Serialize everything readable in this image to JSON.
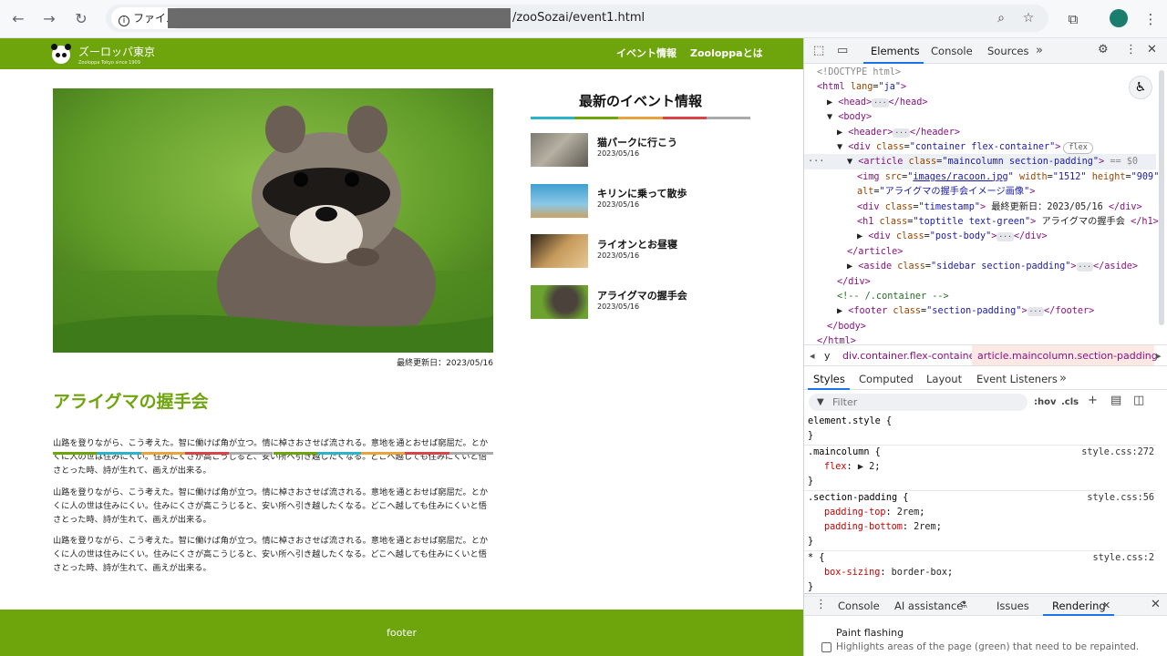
{
  "browser": {
    "file_chip": "ファイル",
    "url_path": "/zooSozai/event1.html",
    "icons": [
      "back-arrow-icon",
      "forward-arrow-icon",
      "reload-icon",
      "zoom-icon",
      "star-icon",
      "extensions-icon",
      "profile-icon",
      "menu-icon"
    ]
  },
  "site": {
    "brand": "ズーロッパ東京",
    "brand_sub": "Zooloppa Tokyo since 1909",
    "nav": [
      "イベント情報",
      "Zooloppaとは"
    ],
    "hero_alt": "アライグマの握手会イメージ画像",
    "timestamp": "最終更新日：2023/05/16",
    "title": "アライグマの握手会",
    "stripe_colors": [
      "#6ea40c",
      "#2bb3c9",
      "#e8a33c",
      "#d9434a",
      "#aaaaaa",
      "#6ea40c",
      "#2bb3c9",
      "#e8a33c",
      "#d9434a",
      "#aaaaaa"
    ],
    "paragraphs": [
      "山路を登りながら、こう考えた。智に働けば角が立つ。情に棹さおさせば流される。意地を通とおせば窮屈だ。とかくに人の世は住みにくい。住みにくさが高こうじると、安い所へ引き越したくなる。どこへ越しても住みにくいと悟さとった時、詩が生れて、画えが出来る。",
      "山路を登りながら、こう考えた。智に働けば角が立つ。情に棹さおさせば流される。意地を通とおせば窮屈だ。とかくに人の世は住みにくい。住みにくさが高こうじると、安い所へ引き越したくなる。どこへ越しても住みにくいと悟さとった時、詩が生れて、画えが出来る。",
      "山路を登りながら、こう考えた。智に働けば角が立つ。情に棹さおさせば流される。意地を通とおせば窮屈だ。とかくに人の世は住みにくい。住みにくさが高こうじると、安い所へ引き越したくなる。どこへ越しても住みにくいと悟さとった時、詩が生れて、画えが出来る。"
    ],
    "sidebar_title": "最新のイベント情報",
    "sidebar_stripe": [
      "#2bb3c9",
      "#6ea40c",
      "#e8a33c",
      "#d9434a",
      "#aaaaaa"
    ],
    "events": [
      {
        "title": "猫パークに行こう",
        "date": "2023/05/16"
      },
      {
        "title": "キリンに乗って散歩",
        "date": "2023/05/16"
      },
      {
        "title": "ライオンとお昼寝",
        "date": "2023/05/16"
      },
      {
        "title": "アライグマの握手会",
        "date": "2023/05/16"
      }
    ],
    "footer": "footer"
  },
  "devtools": {
    "tabs": [
      "Elements",
      "Console",
      "Sources"
    ],
    "dom_lines": [
      {
        "indent": 0,
        "html": "<span class='dim'>&lt;!DOCTYPE html&gt;</span>"
      },
      {
        "indent": 0,
        "html": "<span class='tag'>&lt;html</span> <span class='attr'>lang</span>=<span class='val'>\"ja\"</span><span class='tag'>&gt;</span>"
      },
      {
        "indent": 1,
        "html": "▶ <span class='tag'>&lt;head&gt;</span><span class='ell'>···</span><span class='tag'>&lt;/head&gt;</span>"
      },
      {
        "indent": 1,
        "html": "▼ <span class='tag'>&lt;body&gt;</span>"
      },
      {
        "indent": 2,
        "html": "▶ <span class='tag'>&lt;header&gt;</span><span class='ell'>···</span><span class='tag'>&lt;/header&gt;</span>"
      },
      {
        "indent": 2,
        "html": "▼ <span class='tag'>&lt;div</span> <span class='attr'>class</span>=<span class='val'>\"container flex-container\"</span><span class='tag'>&gt;</span><span class='pill'>flex</span>"
      },
      {
        "indent": 3,
        "html": "▼ <span class='tag'>&lt;article</span> <span class='attr'>class</span>=<span class='val'>\"maincolumn section-padding\"</span><span class='tag'>&gt;</span> <span class='dim'>== $0</span>"
      },
      {
        "indent": 4,
        "html": "<span class='tag'>&lt;img</span> <span class='attr'>src</span>=<span class='val'>\"<u>images/racoon.jpg</u>\"</span> <span class='attr'>width</span>=<span class='val'>\"1512\"</span> <span class='attr'>height</span>=<span class='val'>\"909\"</span>"
      },
      {
        "indent": 4,
        "html": "<span class='attr'>alt</span>=<span class='val'>\"アライグマの握手会イメージ画像\"</span><span class='tag'>&gt;</span>"
      },
      {
        "indent": 4,
        "html": "<span class='tag'>&lt;div</span> <span class='attr'>class</span>=<span class='val'>\"timestamp\"</span><span class='tag'>&gt;</span> 最終更新日：2023/05/16 <span class='tag'>&lt;/div&gt;</span>"
      },
      {
        "indent": 4,
        "html": "<span class='tag'>&lt;h1</span> <span class='attr'>class</span>=<span class='val'>\"toptitle text-green\"</span><span class='tag'>&gt;</span> アライグマの握手会 <span class='tag'>&lt;/h1&gt;</span>"
      },
      {
        "indent": 4,
        "html": "▶ <span class='tag'>&lt;div</span> <span class='attr'>class</span>=<span class='val'>\"post-body\"</span><span class='tag'>&gt;</span><span class='ell'>···</span><span class='tag'>&lt;/div&gt;</span>"
      },
      {
        "indent": 3,
        "html": "<span class='tag'>&lt;/article&gt;</span>"
      },
      {
        "indent": 3,
        "html": "▶ <span class='tag'>&lt;aside</span> <span class='attr'>class</span>=<span class='val'>\"sidebar section-padding\"</span><span class='tag'>&gt;</span><span class='ell'>···</span><span class='tag'>&lt;/aside&gt;</span>"
      },
      {
        "indent": 2,
        "html": "<span class='tag'>&lt;/div&gt;</span>"
      },
      {
        "indent": 2,
        "html": "<span class='cmt'>&lt;!-- /.container --&gt;</span>"
      },
      {
        "indent": 2,
        "html": "▶ <span class='tag'>&lt;footer</span> <span class='attr'>class</span>=<span class='val'>\"section-padding\"</span><span class='tag'>&gt;</span><span class='ell'>···</span><span class='tag'>&lt;/footer&gt;</span>"
      },
      {
        "indent": 1,
        "html": "<span class='tag'>&lt;/body&gt;</span>"
      },
      {
        "indent": 0,
        "html": "<span class='tag'>&lt;/html&gt;</span>"
      }
    ],
    "crumbs": [
      "y",
      "div.container.flex-container",
      "article.maincolumn.section-padding"
    ],
    "styles_tabs": [
      "Styles",
      "Computed",
      "Layout",
      "Event Listeners"
    ],
    "filter_placeholder": "Filter",
    "filter_tools": [
      ":hov",
      ".cls"
    ],
    "rules": [
      {
        "selector": "element.style {",
        "decls": [],
        "source": ""
      },
      {
        "selector": ".maincolumn {",
        "decls": [
          [
            "flex",
            "▶ 2"
          ]
        ],
        "source": "style.css:272"
      },
      {
        "selector": ".section-padding {",
        "decls": [
          [
            "padding-top",
            "2rem"
          ],
          [
            "padding-bottom",
            "2rem"
          ]
        ],
        "source": "style.css:56"
      },
      {
        "selector": "* {",
        "decls": [
          [
            "box-sizing",
            "border-box"
          ]
        ],
        "source": "style.css:2"
      }
    ],
    "drawer_tabs": [
      "Console",
      "AI assistance",
      "Issues",
      "Rendering"
    ],
    "paint_label": "Paint flashing",
    "paint_desc": "Highlights areas of the page (green) that need to be repainted."
  }
}
